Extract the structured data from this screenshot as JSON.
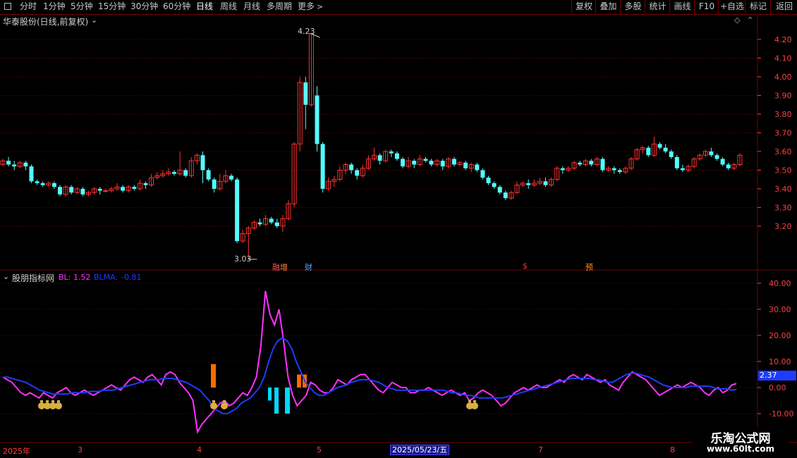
{
  "toolbar": {
    "periods": [
      "分时",
      "1分钟",
      "5分钟",
      "15分钟",
      "30分钟",
      "60分钟",
      "日线",
      "周线",
      "月线",
      "多周期",
      "更多"
    ],
    "active_period": "日线",
    "buttons": [
      "复权",
      "叠加",
      "多股",
      "统计",
      "画线",
      "F10",
      "+自选",
      "标记",
      "返回"
    ]
  },
  "price_panel": {
    "title": "华泰股份(日线,前复权)",
    "high_label": "4.23",
    "low_label": "3.03",
    "event_markers": [
      "融",
      "增",
      "财",
      "$",
      "预"
    ]
  },
  "indicator_panel": {
    "title": "股朋指标网",
    "bl_label": "BL:",
    "bl_value": "1.52",
    "blma_label": "BLMA:",
    "blma_value": "-0.81",
    "current_value_tag": "2.37"
  },
  "date_axis": {
    "labels": [
      "2025年",
      "3",
      "4",
      "5",
      "7",
      "8"
    ],
    "cursor_date": "2025/05/23/五"
  },
  "colors": {
    "up": "#ff3232",
    "down": "#54fcfc",
    "bl": "#ff32ff",
    "blma": "#1e3cff",
    "grid": "#7a0000",
    "axis_text": "#ff4040",
    "orange_bar": "#ff6a00",
    "cyan_bar": "#00d8ff",
    "bag": "#d8b040"
  },
  "chart_data": [
    {
      "type": "candlestick",
      "title": "华泰股份(日线,前复权)",
      "y_ticks": [
        3.2,
        3.3,
        3.4,
        3.5,
        3.6,
        3.7,
        3.8,
        3.9,
        4.0,
        4.1,
        4.2
      ],
      "ylim": [
        3.03,
        4.25
      ],
      "grid": true,
      "candles": [
        [
          3.53,
          3.55,
          3.56,
          3.52
        ],
        [
          3.55,
          3.53,
          3.57,
          3.52
        ],
        [
          3.53,
          3.52,
          3.55,
          3.5
        ],
        [
          3.52,
          3.54,
          3.55,
          3.51
        ],
        [
          3.54,
          3.52,
          3.55,
          3.5
        ],
        [
          3.52,
          3.44,
          3.53,
          3.43
        ],
        [
          3.44,
          3.43,
          3.45,
          3.42
        ],
        [
          3.43,
          3.42,
          3.44,
          3.41
        ],
        [
          3.42,
          3.43,
          3.44,
          3.41
        ],
        [
          3.43,
          3.41,
          3.44,
          3.4
        ],
        [
          3.41,
          3.37,
          3.42,
          3.36
        ],
        [
          3.37,
          3.41,
          3.42,
          3.36
        ],
        [
          3.41,
          3.38,
          3.42,
          3.37
        ],
        [
          3.38,
          3.4,
          3.41,
          3.37
        ],
        [
          3.4,
          3.37,
          3.41,
          3.36
        ],
        [
          3.37,
          3.38,
          3.39,
          3.36
        ],
        [
          3.38,
          3.4,
          3.41,
          3.37
        ],
        [
          3.4,
          3.39,
          3.41,
          3.37
        ],
        [
          3.39,
          3.39,
          3.4,
          3.38
        ],
        [
          3.39,
          3.4,
          3.41,
          3.38
        ],
        [
          3.4,
          3.41,
          3.43,
          3.39
        ],
        [
          3.41,
          3.39,
          3.42,
          3.38
        ],
        [
          3.39,
          3.41,
          3.42,
          3.38
        ],
        [
          3.41,
          3.4,
          3.42,
          3.39
        ],
        [
          3.4,
          3.43,
          3.45,
          3.39
        ],
        [
          3.43,
          3.42,
          3.44,
          3.4
        ],
        [
          3.42,
          3.46,
          3.48,
          3.41
        ],
        [
          3.46,
          3.47,
          3.49,
          3.45
        ],
        [
          3.47,
          3.48,
          3.5,
          3.46
        ],
        [
          3.48,
          3.49,
          3.51,
          3.47
        ],
        [
          3.49,
          3.48,
          3.5,
          3.47
        ],
        [
          3.48,
          3.5,
          3.6,
          3.47
        ],
        [
          3.5,
          3.47,
          3.51,
          3.46
        ],
        [
          3.47,
          3.55,
          3.57,
          3.46
        ],
        [
          3.55,
          3.58,
          3.59,
          3.53
        ],
        [
          3.58,
          3.5,
          3.6,
          3.43
        ],
        [
          3.5,
          3.45,
          3.51,
          3.44
        ],
        [
          3.45,
          3.4,
          3.46,
          3.38
        ],
        [
          3.4,
          3.44,
          3.48,
          3.39
        ],
        [
          3.44,
          3.47,
          3.5,
          3.43
        ],
        [
          3.47,
          3.45,
          3.48,
          3.44
        ],
        [
          3.45,
          3.12,
          3.46,
          3.11
        ],
        [
          3.12,
          3.16,
          3.18,
          3.11
        ],
        [
          3.16,
          3.19,
          3.2,
          3.03
        ],
        [
          3.19,
          3.22,
          3.23,
          3.18
        ],
        [
          3.22,
          3.21,
          3.24,
          3.2
        ],
        [
          3.21,
          3.24,
          3.26,
          3.2
        ],
        [
          3.24,
          3.22,
          3.25,
          3.21
        ],
        [
          3.22,
          3.2,
          3.24,
          3.19
        ],
        [
          3.2,
          3.24,
          3.26,
          3.17
        ],
        [
          3.24,
          3.32,
          3.34,
          3.23
        ],
        [
          3.32,
          3.64,
          3.65,
          3.3
        ],
        [
          3.64,
          3.97,
          4.0,
          3.6
        ],
        [
          3.97,
          3.85,
          4.0,
          3.72
        ],
        [
          3.85,
          4.23,
          4.23,
          3.84
        ],
        [
          3.9,
          3.64,
          3.95,
          3.6
        ],
        [
          3.64,
          3.4,
          3.65,
          3.38
        ],
        [
          3.4,
          3.44,
          3.46,
          3.39
        ],
        [
          3.44,
          3.45,
          3.47,
          3.41
        ],
        [
          3.45,
          3.5,
          3.52,
          3.44
        ],
        [
          3.5,
          3.53,
          3.54,
          3.48
        ],
        [
          3.53,
          3.5,
          3.54,
          3.48
        ],
        [
          3.5,
          3.47,
          3.51,
          3.45
        ],
        [
          3.47,
          3.51,
          3.53,
          3.46
        ],
        [
          3.51,
          3.56,
          3.58,
          3.5
        ],
        [
          3.56,
          3.58,
          3.62,
          3.55
        ],
        [
          3.58,
          3.55,
          3.59,
          3.53
        ],
        [
          3.55,
          3.6,
          3.61,
          3.54
        ],
        [
          3.6,
          3.59,
          3.61,
          3.57
        ],
        [
          3.59,
          3.56,
          3.6,
          3.55
        ],
        [
          3.56,
          3.52,
          3.57,
          3.51
        ],
        [
          3.52,
          3.55,
          3.57,
          3.51
        ],
        [
          3.55,
          3.53,
          3.56,
          3.51
        ],
        [
          3.53,
          3.56,
          3.58,
          3.52
        ],
        [
          3.56,
          3.55,
          3.57,
          3.54
        ],
        [
          3.55,
          3.53,
          3.56,
          3.52
        ],
        [
          3.53,
          3.55,
          3.56,
          3.52
        ],
        [
          3.55,
          3.52,
          3.56,
          3.5
        ],
        [
          3.52,
          3.56,
          3.57,
          3.51
        ],
        [
          3.56,
          3.53,
          3.57,
          3.52
        ],
        [
          3.53,
          3.54,
          3.55,
          3.52
        ],
        [
          3.54,
          3.51,
          3.55,
          3.5
        ],
        [
          3.51,
          3.53,
          3.54,
          3.49
        ],
        [
          3.53,
          3.5,
          3.54,
          3.49
        ],
        [
          3.5,
          3.46,
          3.51,
          3.45
        ],
        [
          3.46,
          3.43,
          3.47,
          3.42
        ],
        [
          3.43,
          3.41,
          3.44,
          3.4
        ],
        [
          3.41,
          3.38,
          3.42,
          3.37
        ],
        [
          3.38,
          3.35,
          3.39,
          3.34
        ],
        [
          3.35,
          3.38,
          3.39,
          3.34
        ],
        [
          3.38,
          3.42,
          3.44,
          3.37
        ],
        [
          3.42,
          3.43,
          3.44,
          3.41
        ],
        [
          3.43,
          3.42,
          3.45,
          3.4
        ],
        [
          3.42,
          3.43,
          3.45,
          3.41
        ],
        [
          3.43,
          3.44,
          3.46,
          3.42
        ],
        [
          3.44,
          3.42,
          3.46,
          3.41
        ],
        [
          3.42,
          3.45,
          3.46,
          3.41
        ],
        [
          3.45,
          3.51,
          3.52,
          3.44
        ],
        [
          3.51,
          3.5,
          3.52,
          3.48
        ],
        [
          3.5,
          3.51,
          3.52,
          3.49
        ],
        [
          3.51,
          3.54,
          3.55,
          3.5
        ],
        [
          3.54,
          3.53,
          3.55,
          3.52
        ],
        [
          3.53,
          3.55,
          3.56,
          3.52
        ],
        [
          3.55,
          3.53,
          3.56,
          3.52
        ],
        [
          3.53,
          3.56,
          3.57,
          3.52
        ],
        [
          3.56,
          3.5,
          3.57,
          3.49
        ],
        [
          3.5,
          3.51,
          3.52,
          3.49
        ],
        [
          3.51,
          3.5,
          3.52,
          3.48
        ],
        [
          3.5,
          3.49,
          3.51,
          3.48
        ],
        [
          3.49,
          3.51,
          3.52,
          3.48
        ],
        [
          3.51,
          3.56,
          3.57,
          3.5
        ],
        [
          3.56,
          3.61,
          3.62,
          3.55
        ],
        [
          3.61,
          3.62,
          3.63,
          3.59
        ],
        [
          3.62,
          3.58,
          3.63,
          3.57
        ],
        [
          3.58,
          3.64,
          3.68,
          3.57
        ],
        [
          3.64,
          3.62,
          3.65,
          3.61
        ],
        [
          3.62,
          3.6,
          3.64,
          3.59
        ],
        [
          3.6,
          3.57,
          3.61,
          3.56
        ],
        [
          3.57,
          3.51,
          3.58,
          3.5
        ],
        [
          3.51,
          3.5,
          3.53,
          3.49
        ],
        [
          3.5,
          3.52,
          3.53,
          3.49
        ],
        [
          3.52,
          3.56,
          3.57,
          3.51
        ],
        [
          3.56,
          3.58,
          3.59,
          3.55
        ],
        [
          3.58,
          3.6,
          3.61,
          3.57
        ],
        [
          3.6,
          3.58,
          3.62,
          3.57
        ],
        [
          3.58,
          3.56,
          3.59,
          3.55
        ],
        [
          3.56,
          3.53,
          3.57,
          3.52
        ],
        [
          3.53,
          3.51,
          3.54,
          3.5
        ],
        [
          3.51,
          3.53,
          3.54,
          3.5
        ],
        [
          3.53,
          3.58,
          3.59,
          3.52
        ]
      ]
    },
    {
      "type": "line",
      "title": "股朋指标网",
      "y_ticks": [
        -10.0,
        0.0,
        10.0,
        20.0,
        30.0,
        40.0
      ],
      "ylim": [
        -18,
        44
      ],
      "grid": true,
      "series": [
        {
          "name": "BL",
          "values": [
            4,
            3,
            2,
            0,
            -2,
            -3,
            -2,
            -3,
            -4,
            -2,
            -3,
            -4,
            -2,
            -1,
            0,
            -2,
            -3,
            -2,
            -1,
            -2,
            -3,
            -2,
            -1,
            0,
            1,
            0,
            -1,
            1,
            3,
            4,
            3,
            2,
            4,
            5,
            3,
            1,
            5,
            6,
            5,
            2,
            0,
            -2,
            -5,
            -17,
            -14,
            -12,
            -10,
            -8,
            -6,
            -5,
            -7,
            -6,
            -4,
            -2,
            -3,
            0,
            4,
            16,
            37,
            28,
            24,
            30,
            18,
            4,
            -3,
            -7,
            -5,
            -3,
            2,
            1,
            -1,
            -2,
            -2,
            0,
            3,
            2,
            1,
            3,
            4,
            5,
            5,
            3,
            1,
            -1,
            -2,
            0,
            2,
            1,
            0,
            0,
            -2,
            -2,
            -1,
            -1,
            0,
            -1,
            -2,
            -3,
            -2,
            -1,
            -2,
            -3,
            -2,
            -5,
            -4,
            -2,
            -1,
            -2,
            -3,
            -5,
            -7,
            -6,
            -4,
            -2,
            -1,
            0,
            -1,
            0,
            1,
            0,
            0,
            1,
            2,
            3,
            2,
            4,
            5,
            4,
            3,
            5,
            4,
            3,
            2,
            3,
            1,
            0,
            -1,
            2,
            4,
            6,
            5,
            4,
            3,
            1,
            -1,
            -3,
            -2,
            -1,
            0,
            1,
            0,
            1,
            2,
            1,
            0,
            -2,
            -3,
            -1,
            0,
            -2,
            -1,
            1,
            1.52
          ]
        },
        {
          "name": "BLMA",
          "values": [
            4,
            4,
            3.5,
            3,
            2.5,
            2,
            1,
            0,
            -1,
            -1.5,
            -2,
            -2.5,
            -2.5,
            -2.5,
            -2.5,
            -2,
            -2,
            -2,
            -2,
            -1.5,
            -1.5,
            -1.5,
            -1,
            -1,
            -1,
            -0.5,
            0,
            0.5,
            1,
            1.5,
            2,
            2.5,
            3,
            3,
            3,
            3.5,
            3.5,
            3.5,
            3,
            2.5,
            2,
            1,
            0,
            -1,
            -3,
            -5,
            -8,
            -9,
            -10,
            -10,
            -9,
            -8,
            -6,
            -5,
            -4,
            -2,
            0,
            4,
            10,
            15,
            18,
            19,
            18,
            15,
            10,
            6,
            2,
            0,
            -2,
            -3,
            -3,
            -2,
            -1,
            0,
            0.5,
            1,
            2,
            2.5,
            3,
            3,
            3,
            2.5,
            2,
            1,
            0,
            -0.5,
            -1,
            -1,
            -1,
            -1,
            -1,
            -1,
            -1,
            -1,
            -1,
            -1,
            -1,
            -1.5,
            -2,
            -2,
            -2.5,
            -3,
            -3,
            -3.5,
            -4,
            -4,
            -4,
            -4,
            -4,
            -4,
            -3.5,
            -3,
            -2.5,
            -2,
            -1.5,
            -1,
            -0.5,
            0,
            0.5,
            1,
            1.5,
            2,
            2.5,
            3,
            3.5,
            3.5,
            3.5,
            3.5,
            3.5,
            3,
            3,
            2.5,
            2,
            2,
            3,
            4,
            5,
            5.5,
            5.5,
            5,
            4.5,
            4,
            3,
            2,
            1,
            0.5,
            0,
            0,
            0,
            0,
            0.5,
            0.5,
            0.5,
            0.5,
            0.5,
            0,
            -0.5,
            -0.5,
            -0.5,
            -1,
            -0.81
          ]
        }
      ]
    }
  ]
}
